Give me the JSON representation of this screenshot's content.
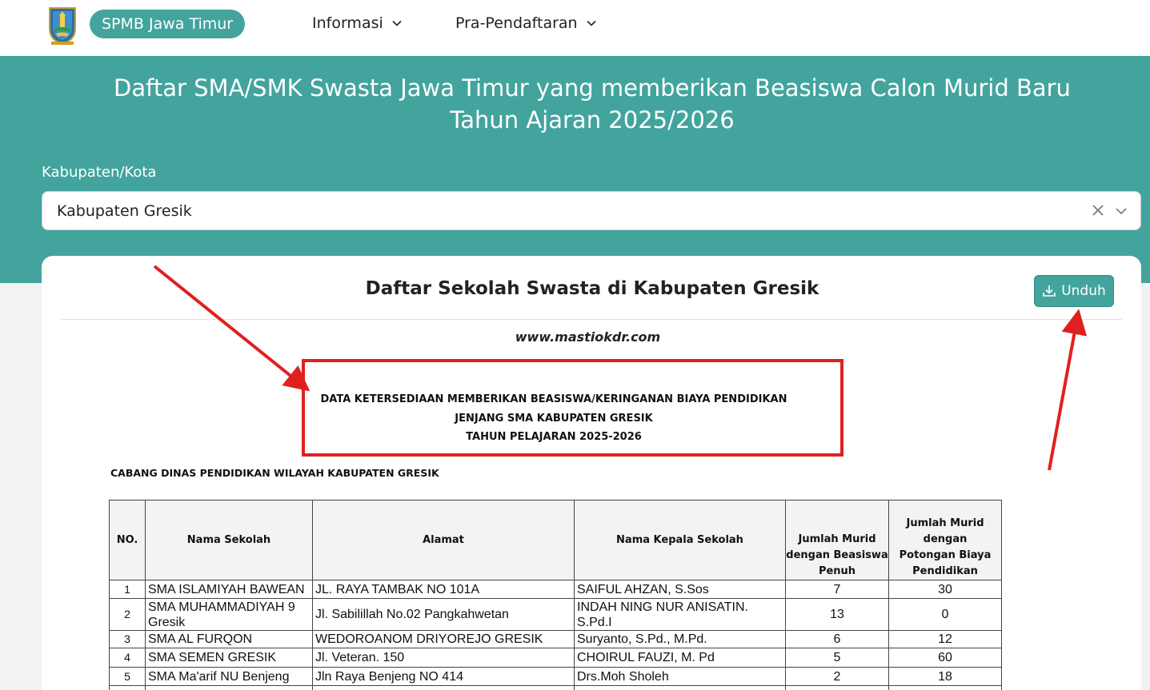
{
  "nav": {
    "brand": "SPMB Jawa Timur",
    "items": [
      {
        "label": "Informasi"
      },
      {
        "label": "Pra-Pendaftaran"
      }
    ]
  },
  "banner": {
    "title_line1": "Daftar SMA/SMK Swasta Jawa Timur yang memberikan Beasiswa Calon Murid Baru",
    "title_line2": "Tahun Ajaran 2025/2026",
    "filter_label": "Kabupaten/Kota",
    "filter_value": "Kabupaten Gresik"
  },
  "card": {
    "title": "Daftar Sekolah Swasta di Kabupaten Gresik",
    "download_label": "Unduh"
  },
  "document": {
    "watermark": "www.mastiokdr.com",
    "heading_1": "DATA KETERSEDIAAN MEMBERIKAN BEASISWA/KERINGANAN BIAYA PENDIDIKAN",
    "heading_2": "JENJANG SMA KABUPATEN GRESIK",
    "heading_3": "TAHUN PELAJARAN 2025-2026",
    "subheading": "CABANG DINAS PENDIDIKAN WILAYAH KABUPATEN GRESIK",
    "columns": {
      "no": "NO.",
      "nama": "Nama Sekolah",
      "alamat": "Alamat",
      "kepala": "Nama Kepala Sekolah",
      "beasiswa_1": "Jumlah Murid",
      "beasiswa_2": "dengan Beasiswa",
      "beasiswa_3": "Penuh",
      "potongan_1": "Jumlah Murid",
      "potongan_2": "dengan",
      "potongan_3": "Potongan Biaya",
      "potongan_4": "Pendidikan"
    },
    "rows": [
      {
        "no": "1",
        "nama": "SMA ISLAMIYAH BAWEAN",
        "alamat": "JL. RAYA TAMBAK NO 101A",
        "kepala": "SAIFUL AHZAN, S.Sos",
        "beasiswa": "7",
        "potongan": "30"
      },
      {
        "no": "2",
        "nama": "SMA MUHAMMADIYAH 9 Gresik",
        "alamat": "Jl. Sabilillah No.02 Pangkahwetan",
        "kepala": "INDAH NING NUR ANISATIN. S.Pd.I",
        "beasiswa": "13",
        "potongan": "0"
      },
      {
        "no": "3",
        "nama": "SMA AL FURQON",
        "alamat": "WEDOROANOM DRIYOREJO GRESIK",
        "kepala": "Suryanto, S.Pd., M.Pd.",
        "beasiswa": "6",
        "potongan": "12"
      },
      {
        "no": "4",
        "nama": "SMA SEMEN GRESIK",
        "alamat": "Jl. Veteran. 150",
        "kepala": "CHOIRUL FAUZI, M. Pd",
        "beasiswa": "5",
        "potongan": "60"
      },
      {
        "no": "5",
        "nama": "SMA Ma'arif NU Benjeng",
        "alamat": "Jln Raya Benjeng NO 414",
        "kepala": "Drs.Moh Sholeh",
        "beasiswa": "2",
        "potongan": "18"
      }
    ]
  },
  "colors": {
    "teal": "#43a49e",
    "annotation_red": "#e02020"
  }
}
